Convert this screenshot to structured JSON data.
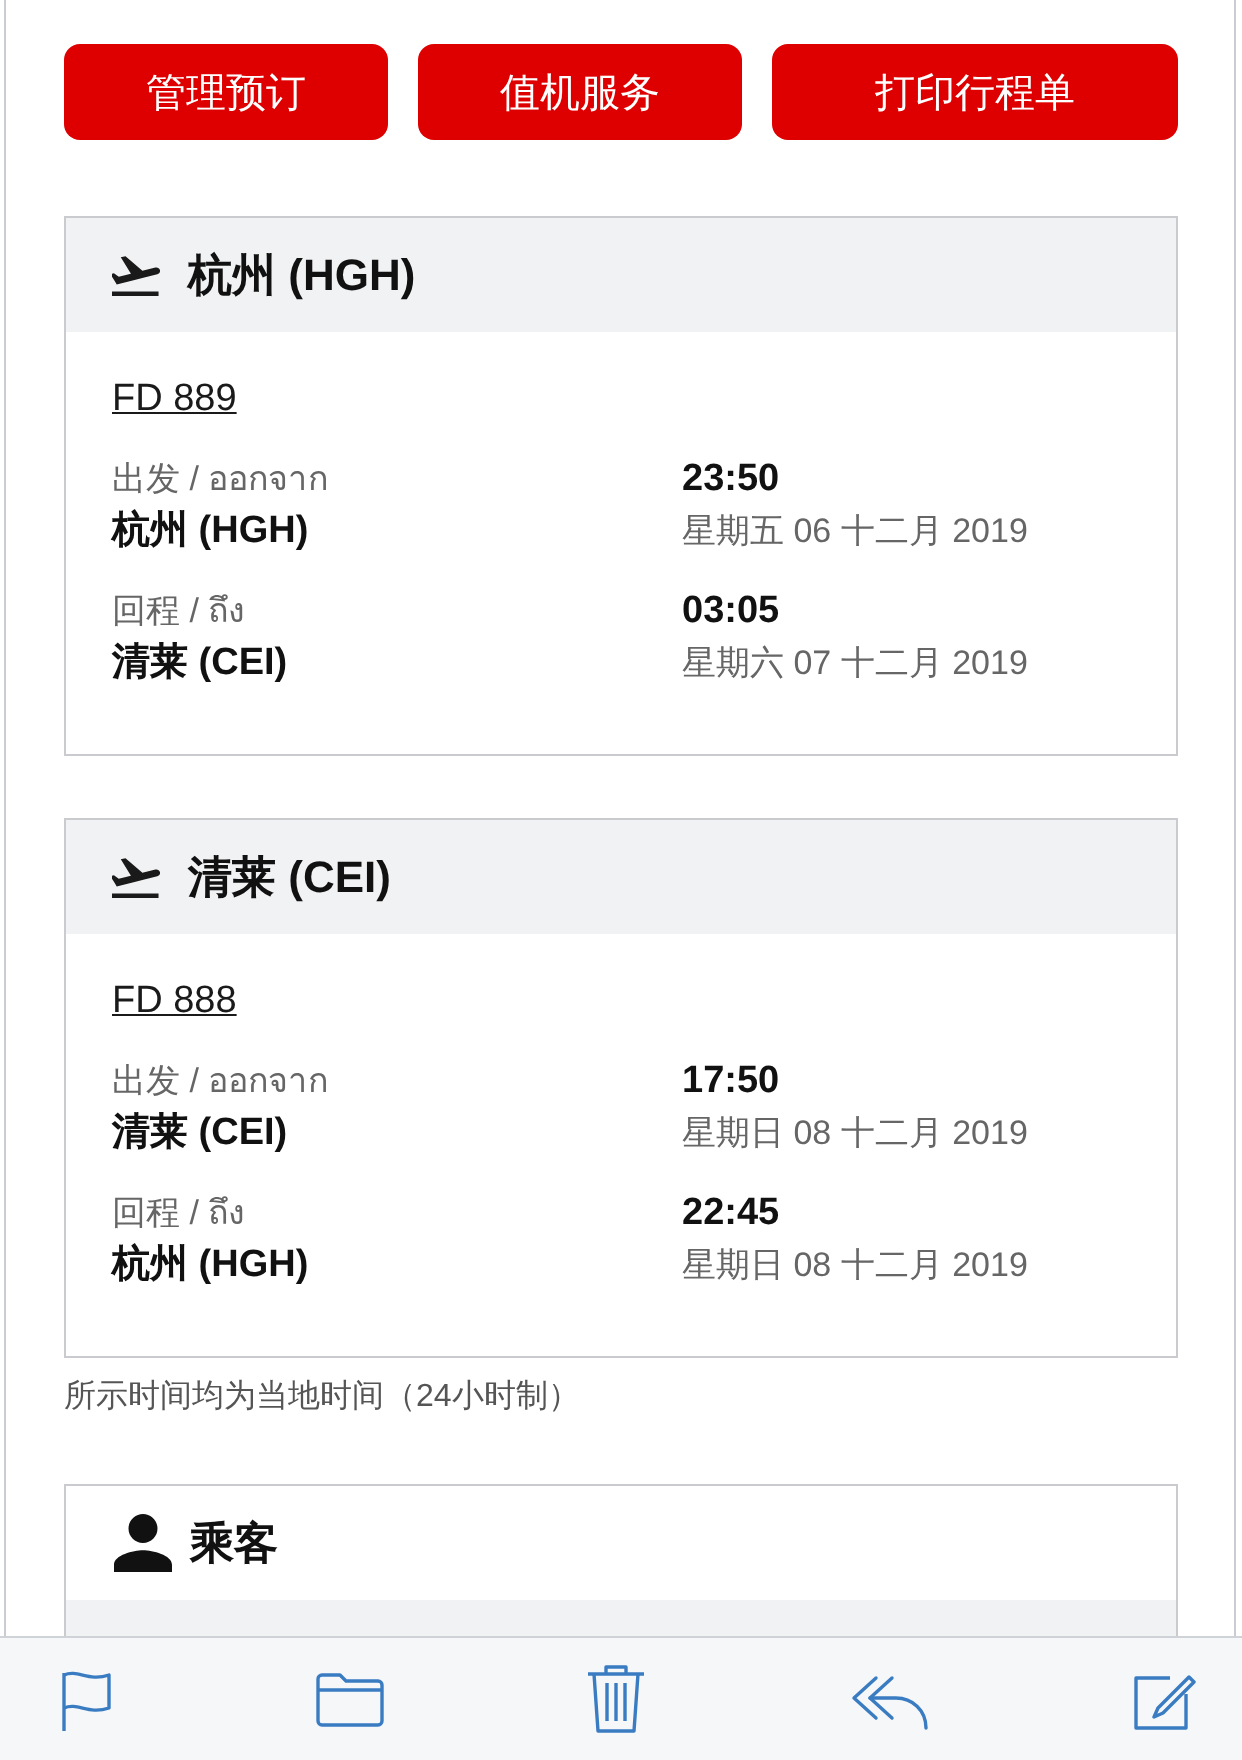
{
  "action_buttons": [
    {
      "label": "管理预订"
    },
    {
      "label": "值机服务"
    },
    {
      "label": "打印行程单"
    }
  ],
  "flights": [
    {
      "heading": "杭州 (HGH)",
      "flight_number": "FD 889",
      "legs": [
        {
          "label": "出发 / ออกจาก",
          "place": "杭州 (HGH)",
          "time": "23:50",
          "date": "星期五 06 十二月 2019"
        },
        {
          "label": "回程 / ถึง",
          "place": "清莱 (CEI)",
          "time": "03:05",
          "date": "星期六 07 十二月 2019"
        }
      ]
    },
    {
      "heading": "清莱 (CEI)",
      "flight_number": "FD 888",
      "legs": [
        {
          "label": "出发 / ออกจาก",
          "place": "清莱 (CEI)",
          "time": "17:50",
          "date": "星期日 08 十二月 2019"
        },
        {
          "label": "回程 / ถึง",
          "place": "杭州 (HGH)",
          "time": "22:45",
          "date": "星期日 08 十二月 2019"
        }
      ]
    }
  ],
  "note": "所示时间均为当地时间（24小时制）",
  "passengers": {
    "heading": "乘客"
  }
}
